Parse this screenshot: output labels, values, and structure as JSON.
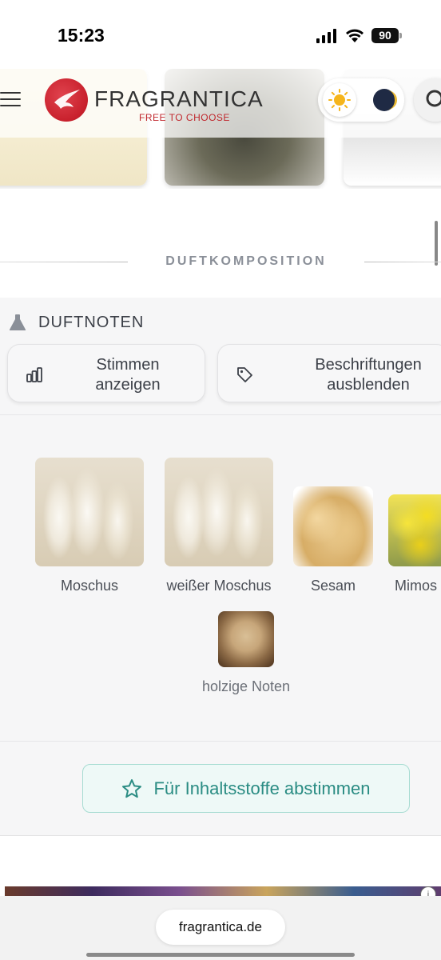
{
  "status_bar": {
    "time": "15:23",
    "battery": "90"
  },
  "header": {
    "brand": "FRAGRANTICA",
    "tagline": "FREE TO CHOOSE",
    "brand_color": "#c0272d"
  },
  "section": {
    "title": "DUFTKOMPOSITION"
  },
  "notes_panel": {
    "heading": "DUFTNOTEN",
    "show_votes_label": "Stimmen anzeigen",
    "hide_labels_label": "Beschriftungen ausblenden",
    "notes": [
      {
        "name": "Moschus",
        "icon": "moschus-image"
      },
      {
        "name": "weißer Moschus",
        "icon": "weisser-moschus-image"
      },
      {
        "name": "Sesam",
        "icon": "sesam-image"
      },
      {
        "name": "Mimos",
        "icon": "mimosa-image"
      },
      {
        "name": "holzige Noten",
        "icon": "holzige-noten-image"
      }
    ],
    "vote_button_label": "Für Inhaltsstoffe abstimmen",
    "accent_color": "#2a8c83"
  },
  "browser": {
    "url": "fragrantica.de"
  }
}
